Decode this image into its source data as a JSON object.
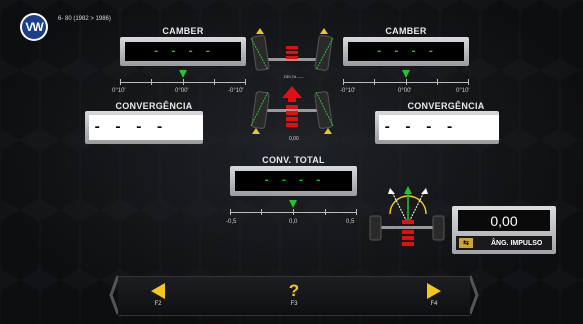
{
  "header": {
    "model": "6- 80 (1982 > 1986)",
    "brand_icon": "vw-logo-icon",
    "brand_mark": "VW"
  },
  "camber_left": {
    "title": "CAMBER",
    "value": "- - - -",
    "scale": [
      "0°10'",
      "0°00'",
      "-0°10'"
    ]
  },
  "camber_right": {
    "title": "CAMBER",
    "value": "- - - -",
    "scale": [
      "-0°10'",
      "0°00'",
      "0°10'"
    ]
  },
  "conv_left": {
    "title": "CONVERGÊNCIA",
    "value": "- - - -"
  },
  "conv_right": {
    "title": "CONVERGÊNCIA",
    "value": "- - - -"
  },
  "center": {
    "delta_label": "DELTA",
    "delta_value": "-----",
    "value": "0,00"
  },
  "conv_total": {
    "title": "CONV. TOTAL",
    "value": "- - - -",
    "scale": [
      "-0,5",
      "0,0",
      "0,5"
    ]
  },
  "impulso": {
    "value": "0,00",
    "label": "ÂNG. IMPULSO",
    "icon": "thrust-angle-icon"
  },
  "nav": {
    "left_key": "F2",
    "help_key": "F3",
    "help_glyph": "?",
    "right_key": "F4"
  },
  "colors": {
    "accent_green": "#25c32c",
    "accent_yellow": "#f5c518",
    "accent_red": "#e01010"
  }
}
